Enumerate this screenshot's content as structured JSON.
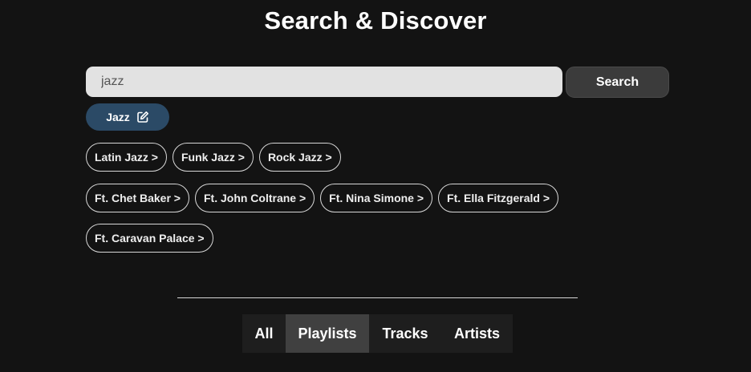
{
  "header": {
    "title": "Search & Discover"
  },
  "search": {
    "value": "jazz",
    "button_label": "Search"
  },
  "active_filter": {
    "label": "Jazz",
    "icon": "edit-icon"
  },
  "suggestions": {
    "genres": [
      "Latin Jazz >",
      "Funk Jazz >",
      "Rock Jazz >"
    ],
    "featured": [
      "Ft. Chet Baker >",
      "Ft. John Coltrane >",
      "Ft. Nina Simone >",
      "Ft. Ella Fitzgerald >",
      "Ft. Caravan Palace >"
    ]
  },
  "tabs": [
    {
      "label": "All",
      "active": false
    },
    {
      "label": "Playlists",
      "active": true
    },
    {
      "label": "Tracks",
      "active": false
    },
    {
      "label": "Artists",
      "active": false
    }
  ],
  "colors": {
    "background": "#131313",
    "chip_active": "#2b4a66",
    "tab_active": "#404040"
  }
}
